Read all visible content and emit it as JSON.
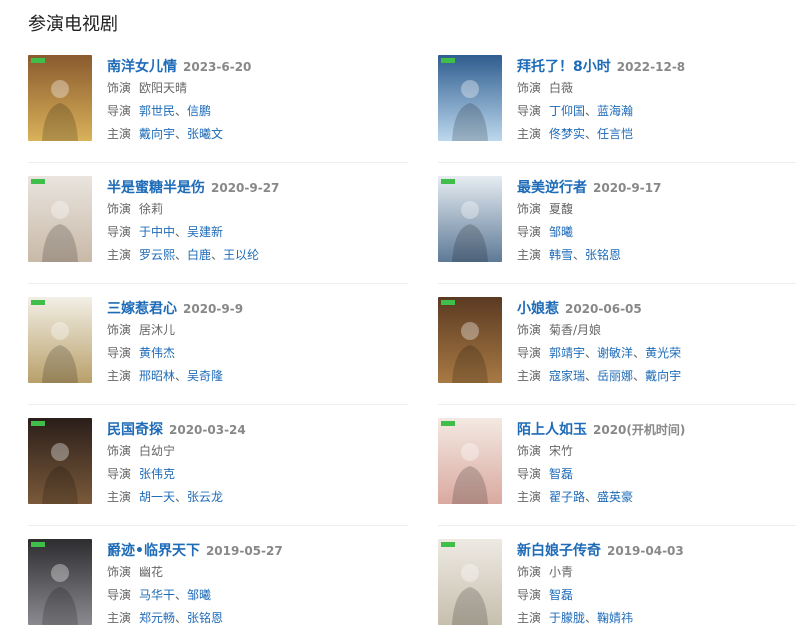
{
  "section_title": "参演电视剧",
  "labels": {
    "role": "饰演",
    "director": "导演",
    "cast": "主演",
    "sep": "、"
  },
  "dramas": [
    {
      "title": "南洋女儿情",
      "date": "2023-6-20",
      "role": "欧阳天晴",
      "director": [
        "郭世民",
        "信鹏"
      ],
      "cast": [
        "戴向宇",
        "张曦文"
      ],
      "poster_colors": [
        "#8a5a2e",
        "#d9b25a"
      ]
    },
    {
      "title": "拜托了！8小时",
      "date": "2022-12-8",
      "role": "白薇",
      "director": [
        "丁仰国",
        "蓝海瀚"
      ],
      "cast": [
        "佟梦实",
        "任言恺"
      ],
      "poster_colors": [
        "#2f5d8f",
        "#bcd8ee"
      ]
    },
    {
      "title": "半是蜜糖半是伤",
      "date": "2020-9-27",
      "role": "徐莉",
      "director": [
        "于中中",
        "吴建新"
      ],
      "cast": [
        "罗云熙",
        "白鹿",
        "王以纶"
      ],
      "poster_colors": [
        "#e9e4de",
        "#c9b9a8"
      ]
    },
    {
      "title": "最美逆行者",
      "date": "2020-9-17",
      "role": "夏馥",
      "director": [
        "邹曦"
      ],
      "cast": [
        "韩雪",
        "张铭恩"
      ],
      "poster_colors": [
        "#e6ecf2",
        "#5e7a97"
      ]
    },
    {
      "title": "三嫁惹君心",
      "date": "2020-9-9",
      "role": "居沐儿",
      "director": [
        "黄伟杰"
      ],
      "cast": [
        "邢昭林",
        "吴奇隆"
      ],
      "poster_colors": [
        "#f2efe6",
        "#b9a06a"
      ]
    },
    {
      "title": "小娘惹",
      "date": "2020-06-05",
      "role": "菊香/月娘",
      "director": [
        "郭靖宇",
        "谢敏洋",
        "黄光荣"
      ],
      "cast": [
        "寇家瑞",
        "岳丽娜",
        "戴向宇"
      ],
      "poster_colors": [
        "#5b3a22",
        "#a87a44"
      ]
    },
    {
      "title": "民国奇探",
      "date": "2020-03-24",
      "role": "白幼宁",
      "director": [
        "张伟克"
      ],
      "cast": [
        "胡一天",
        "张云龙"
      ],
      "poster_colors": [
        "#2a1e1a",
        "#7a5a3a"
      ]
    },
    {
      "title": "陌上人如玉",
      "date": "2020(开机时间)",
      "role": "宋竹",
      "director": [
        "智磊"
      ],
      "cast": [
        "翟子路",
        "盛英豪"
      ],
      "poster_colors": [
        "#f3e9e2",
        "#d9a9a0"
      ]
    },
    {
      "title": "爵迹•临界天下",
      "date": "2019-05-27",
      "role": "幽花",
      "director": [
        "马华干",
        "邹曦"
      ],
      "cast": [
        "郑元畅",
        "张铭恩"
      ],
      "poster_colors": [
        "#2d2d30",
        "#8a8a90"
      ]
    },
    {
      "title": "新白娘子传奇",
      "date": "2019-04-03",
      "role": "小青",
      "director": [
        "智磊"
      ],
      "cast": [
        "于朦胧",
        "鞠婧祎"
      ],
      "poster_colors": [
        "#eeeae3",
        "#c7bfae"
      ]
    }
  ]
}
